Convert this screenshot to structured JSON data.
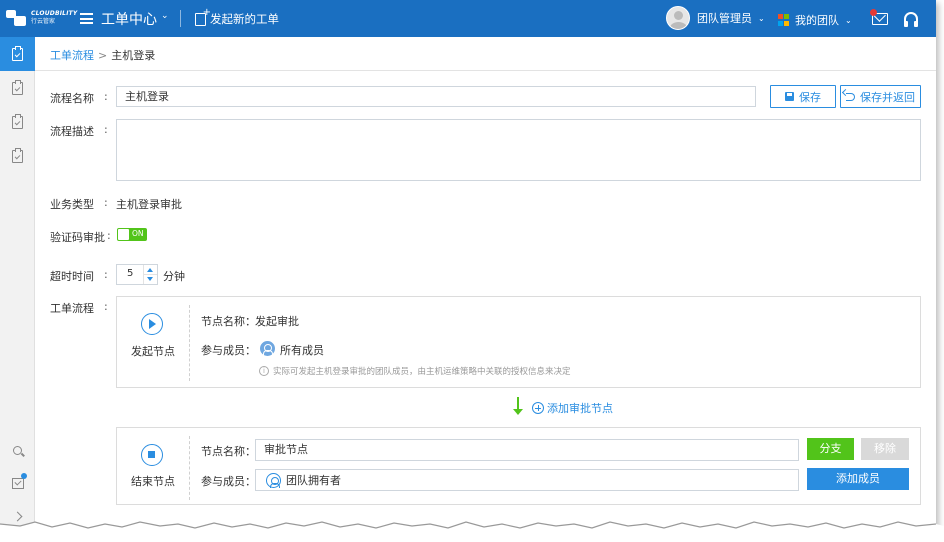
{
  "brand": {
    "logo_line1": "CLOUDBILITY",
    "logo_line2": "行云管家"
  },
  "topbar": {
    "app_title": "工单中心",
    "new_ticket": "发起新的工单",
    "user_name": "团队管理员",
    "team_label": "我的团队",
    "win_colors": [
      "#f25022",
      "#7fba00",
      "#00a4ef",
      "#ffb900"
    ]
  },
  "breadcrumb": {
    "parent": "工单流程",
    "separator": ">",
    "current": "主机登录"
  },
  "form": {
    "name_label": "流程名称",
    "name_value": "主机登录",
    "desc_label": "流程描述",
    "desc_value": "",
    "save_label": "保存",
    "save_return_label": "保存并返回",
    "biz_type_label": "业务类型",
    "biz_type_value": "主机登录审批",
    "captcha_label": "验证码审批",
    "captcha_state": "ON",
    "timeout_label": "超时时间",
    "timeout_value": "5",
    "timeout_unit": "分钟",
    "flow_label": "工单流程",
    "colon": ":"
  },
  "start_node": {
    "title": "发起节点",
    "name_label": "节点名称：",
    "name_value": "发起审批",
    "members_label": "参与成员：",
    "members_value": "所有成员",
    "hint": "实际可发起主机登录审批的团队成员，由主机运维策略中关联的授权信息来决定"
  },
  "add_node_label": "添加审批节点",
  "end_node": {
    "title": "结束节点",
    "name_label": "节点名称：",
    "name_value": "审批节点",
    "members_label": "参与成员：",
    "members_value": "团队拥有者",
    "branch_label": "分支",
    "remove_label": "移除",
    "add_member_label": "添加成员"
  },
  "colors": {
    "topbar": "#1a6fc1",
    "accent": "#2a8de0",
    "green": "#52c41a",
    "disabled": "#d9d9d9"
  }
}
